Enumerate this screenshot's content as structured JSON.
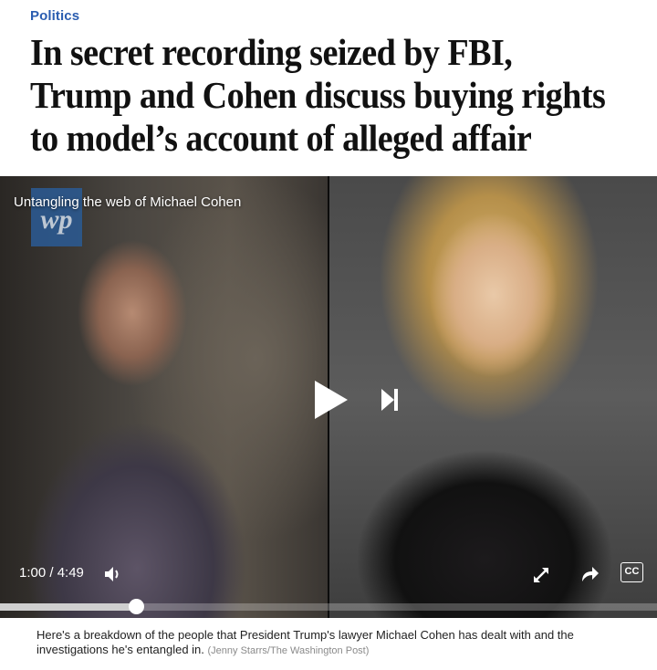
{
  "article": {
    "kicker": "Politics",
    "headline": "In secret recording seized by FBI, Trump and Cohen discuss buying rights to model’s account of alleged affair"
  },
  "video": {
    "title": "Untangling the web of Michael Cohen",
    "logo_text": "wp",
    "current_time": "1:00",
    "duration": "4:49",
    "time_display": "1:00 / 4:49",
    "progress_fraction": 0.2076,
    "cc_label": "CC",
    "controls": {
      "play": "play-icon",
      "next": "skip-next-icon",
      "volume": "volume-icon",
      "fullscreen": "expand-icon",
      "share": "share-icon"
    }
  },
  "caption": {
    "text": "Here's a breakdown of the people that President Trump's lawyer Michael Cohen has dealt with and the investigations he's entangled in.",
    "credit": "(Jenny Starrs/The Washington Post)"
  },
  "colors": {
    "kicker": "#2a5db0",
    "headline": "#111111",
    "player_bg": "#1a1a1a",
    "progress_fill": "#cfcfcf"
  }
}
